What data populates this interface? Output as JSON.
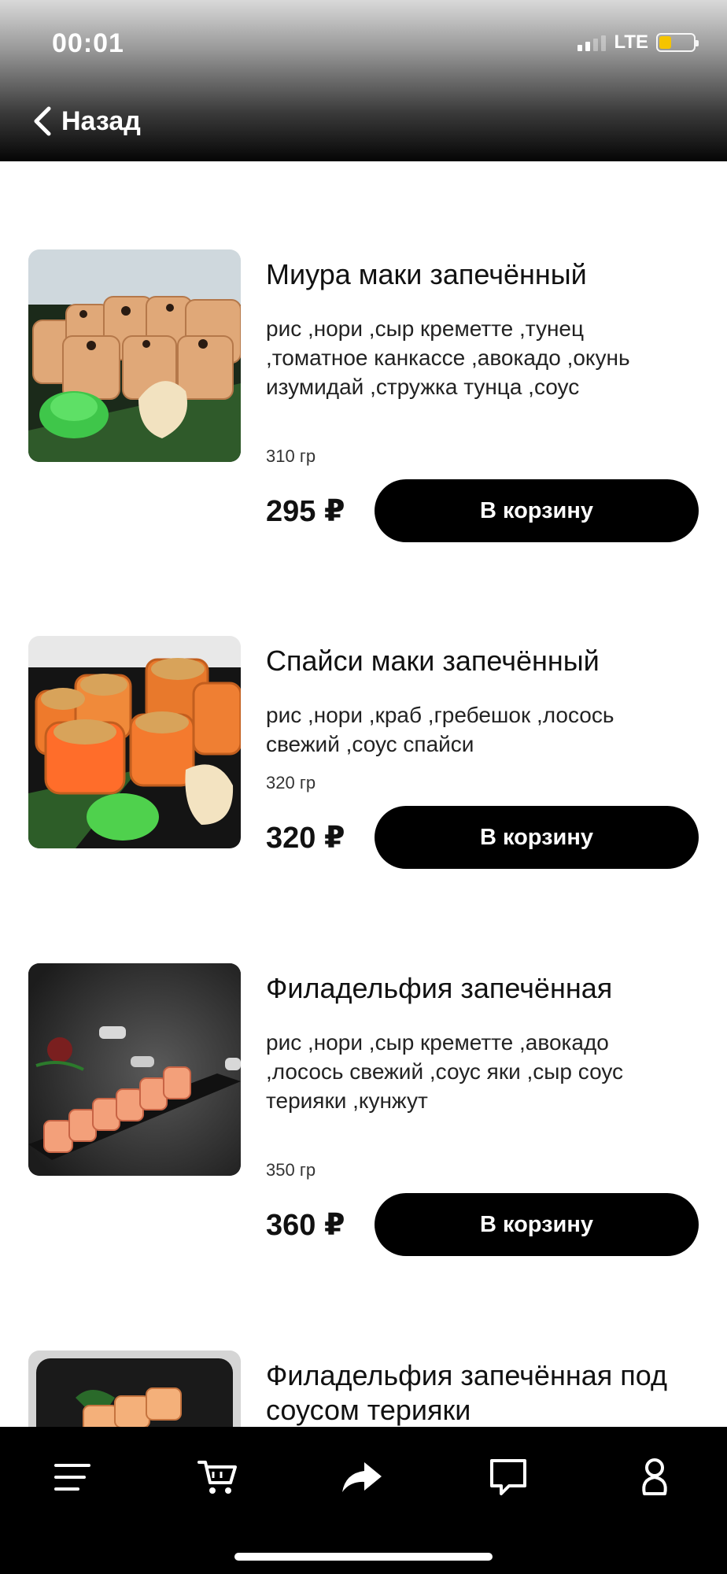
{
  "status_bar": {
    "time": "00:01",
    "network": "LTE",
    "battery_color": "#f5c400",
    "battery_level": 0.35
  },
  "nav": {
    "back_label": "Назад",
    "icon": "chevron-left-icon"
  },
  "products": [
    {
      "title": "Миура маки запечённый",
      "description": "рис ,нори ,сыр креметте ,тунец ,томатное канкассе ,авокадо ,окунь изумидай ,стружка тунца ,соус",
      "weight": "310 гр",
      "price": "295 ₽",
      "button": "В корзину"
    },
    {
      "title": "Спайси маки запечённый",
      "description": "рис ,нори ,краб ,гребешок ,лосось свежий ,соус спайси",
      "weight": "320 гр",
      "price": "320 ₽",
      "button": "В корзину"
    },
    {
      "title": "Филадельфия запечённая",
      "description": "рис ,нори ,сыр креметте ,авокадо ,лосось свежий ,соус яки ,сыр соус терияки ,кунжут",
      "weight": "350 гр",
      "price": "360 ₽",
      "button": "В корзину"
    },
    {
      "title": "Филадельфия запечённая под соусом терияки"
    }
  ],
  "bottom_nav": {
    "items": [
      "menu-icon",
      "cart-icon",
      "share-icon",
      "chat-icon",
      "profile-icon"
    ]
  },
  "colors": {
    "button_bg": "#000000",
    "button_text": "#ffffff",
    "nav_bg": "#000000"
  }
}
